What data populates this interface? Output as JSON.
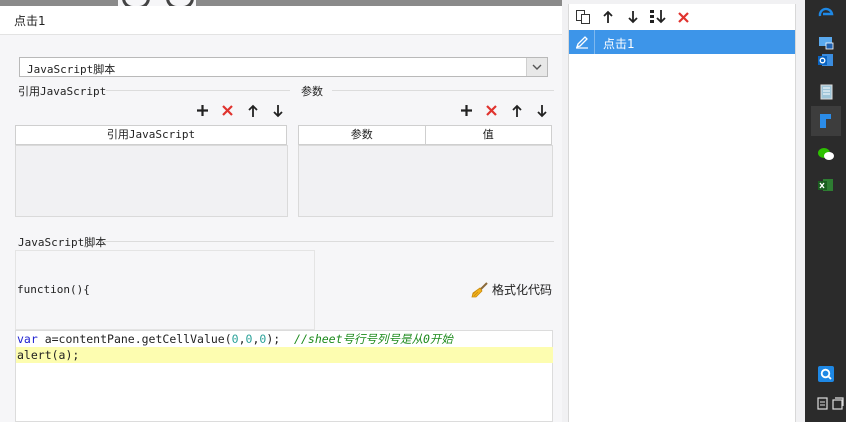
{
  "window": {
    "title": "点击1"
  },
  "type_select": {
    "value": "JavaScript脚本"
  },
  "ref_js": {
    "label": "引用JavaScript",
    "column": "引用JavaScript"
  },
  "params": {
    "label": "参数",
    "columns": [
      "参数",
      "值"
    ]
  },
  "script": {
    "label": "JavaScript脚本",
    "function_header": "function(){",
    "format_button": "格式化代码",
    "code": {
      "line1": {
        "kw": "var",
        "a": " a=contentPane.getCellValue(",
        "n1": "0",
        "c1": ",",
        "n2": "0",
        "c2": ",",
        "n3": "0",
        "end": ");  ",
        "comment": "//sheet号行号列号是从0开始"
      },
      "line2": "alert(a);"
    }
  },
  "events": {
    "items": [
      {
        "label": "点击1",
        "selected": true
      }
    ]
  },
  "toolbar_icons": {
    "ref": [
      "add-icon",
      "delete-icon",
      "up-arrow-icon",
      "down-arrow-icon"
    ],
    "params": [
      "add-icon",
      "delete-icon",
      "up-arrow-icon",
      "down-arrow-icon"
    ],
    "events": [
      "copy-icon",
      "up-arrow-icon",
      "down-arrow-icon",
      "move-bottom-icon",
      "delete-icon"
    ]
  },
  "colors": {
    "accent": "#3d95e9",
    "delete": "#e0332e",
    "code_highlight": "#fdfdb0"
  }
}
